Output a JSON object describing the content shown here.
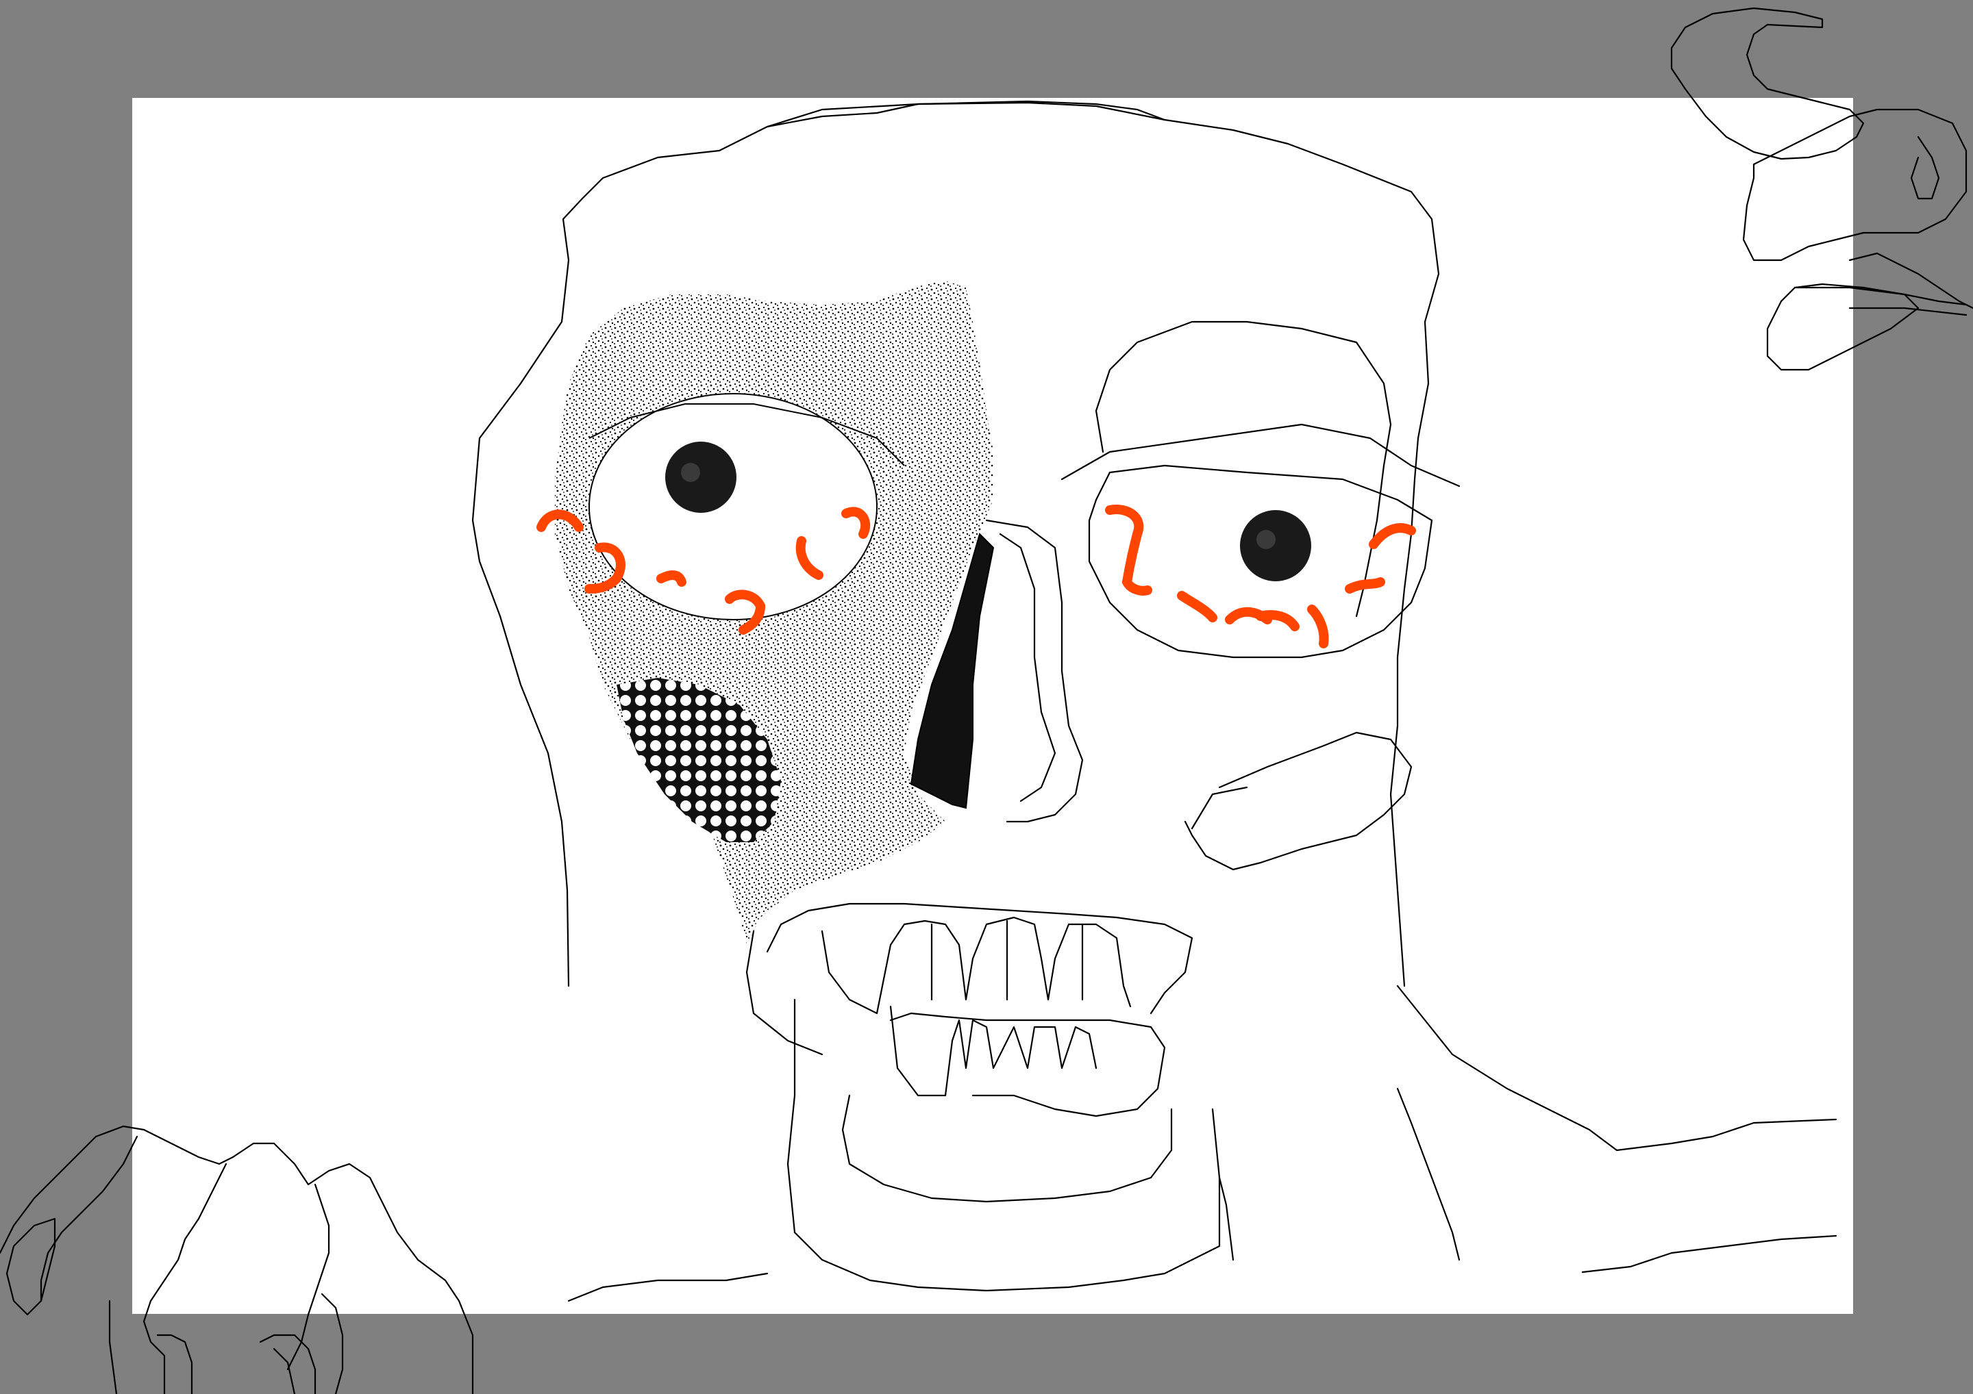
{
  "app": {
    "workspace_color": "#808080",
    "canvas_color": "#ffffff"
  },
  "drawing": {
    "subject": "",
    "line_color": "#000000",
    "accent_color": "#ff4500",
    "icons": [
      "creature-face",
      "claw-top-right",
      "claw-bottom-left"
    ]
  }
}
